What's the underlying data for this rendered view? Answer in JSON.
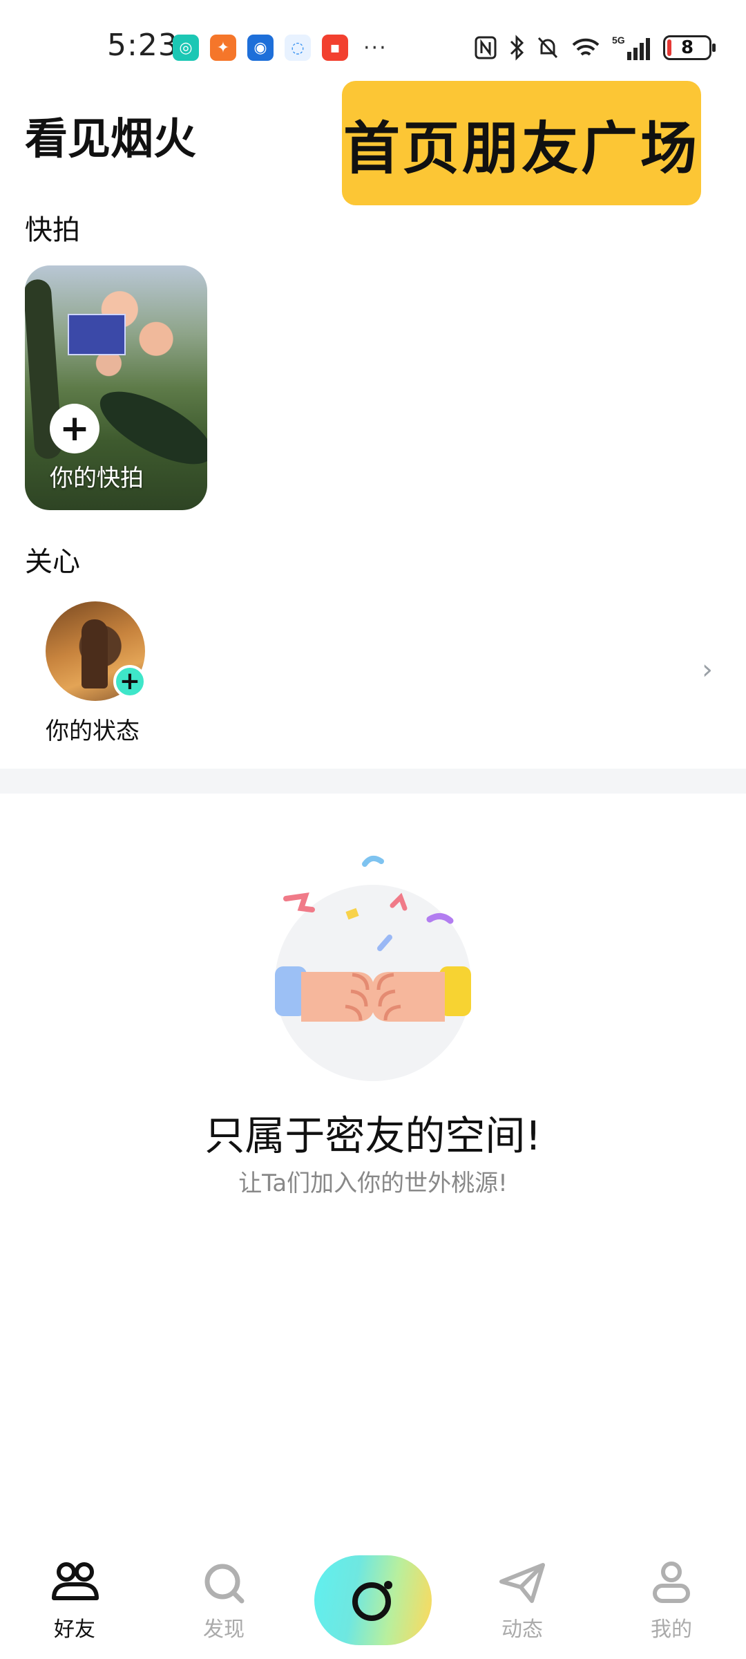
{
  "status_bar": {
    "time": "5:23",
    "more": "···",
    "battery": "8",
    "network": "5G"
  },
  "header": {
    "title": "看见烟火",
    "banner": "首页朋友广场"
  },
  "snapshots": {
    "label": "快拍",
    "card_label": "你的快拍",
    "add_symbol": "+"
  },
  "care": {
    "label": "关心",
    "status_label": "你的状态",
    "add_symbol": "+",
    "more": "›"
  },
  "empty_state": {
    "title": "只属于密友的空间!",
    "subtitle": "让Ta们加入你的世外桃源!"
  },
  "bottom_nav": {
    "items": [
      {
        "label": "好友",
        "icon": "friends-icon",
        "active": true
      },
      {
        "label": "发现",
        "icon": "search-icon",
        "active": false
      },
      {
        "label": "",
        "icon": "camera-icon",
        "active": false
      },
      {
        "label": "动态",
        "icon": "paper-plane-icon",
        "active": false
      },
      {
        "label": "我的",
        "icon": "profile-icon",
        "active": false
      }
    ]
  },
  "colors": {
    "banner_bg": "#fcc635",
    "accent_teal": "#3ee6c9",
    "inactive_nav": "#aaaaaa"
  }
}
